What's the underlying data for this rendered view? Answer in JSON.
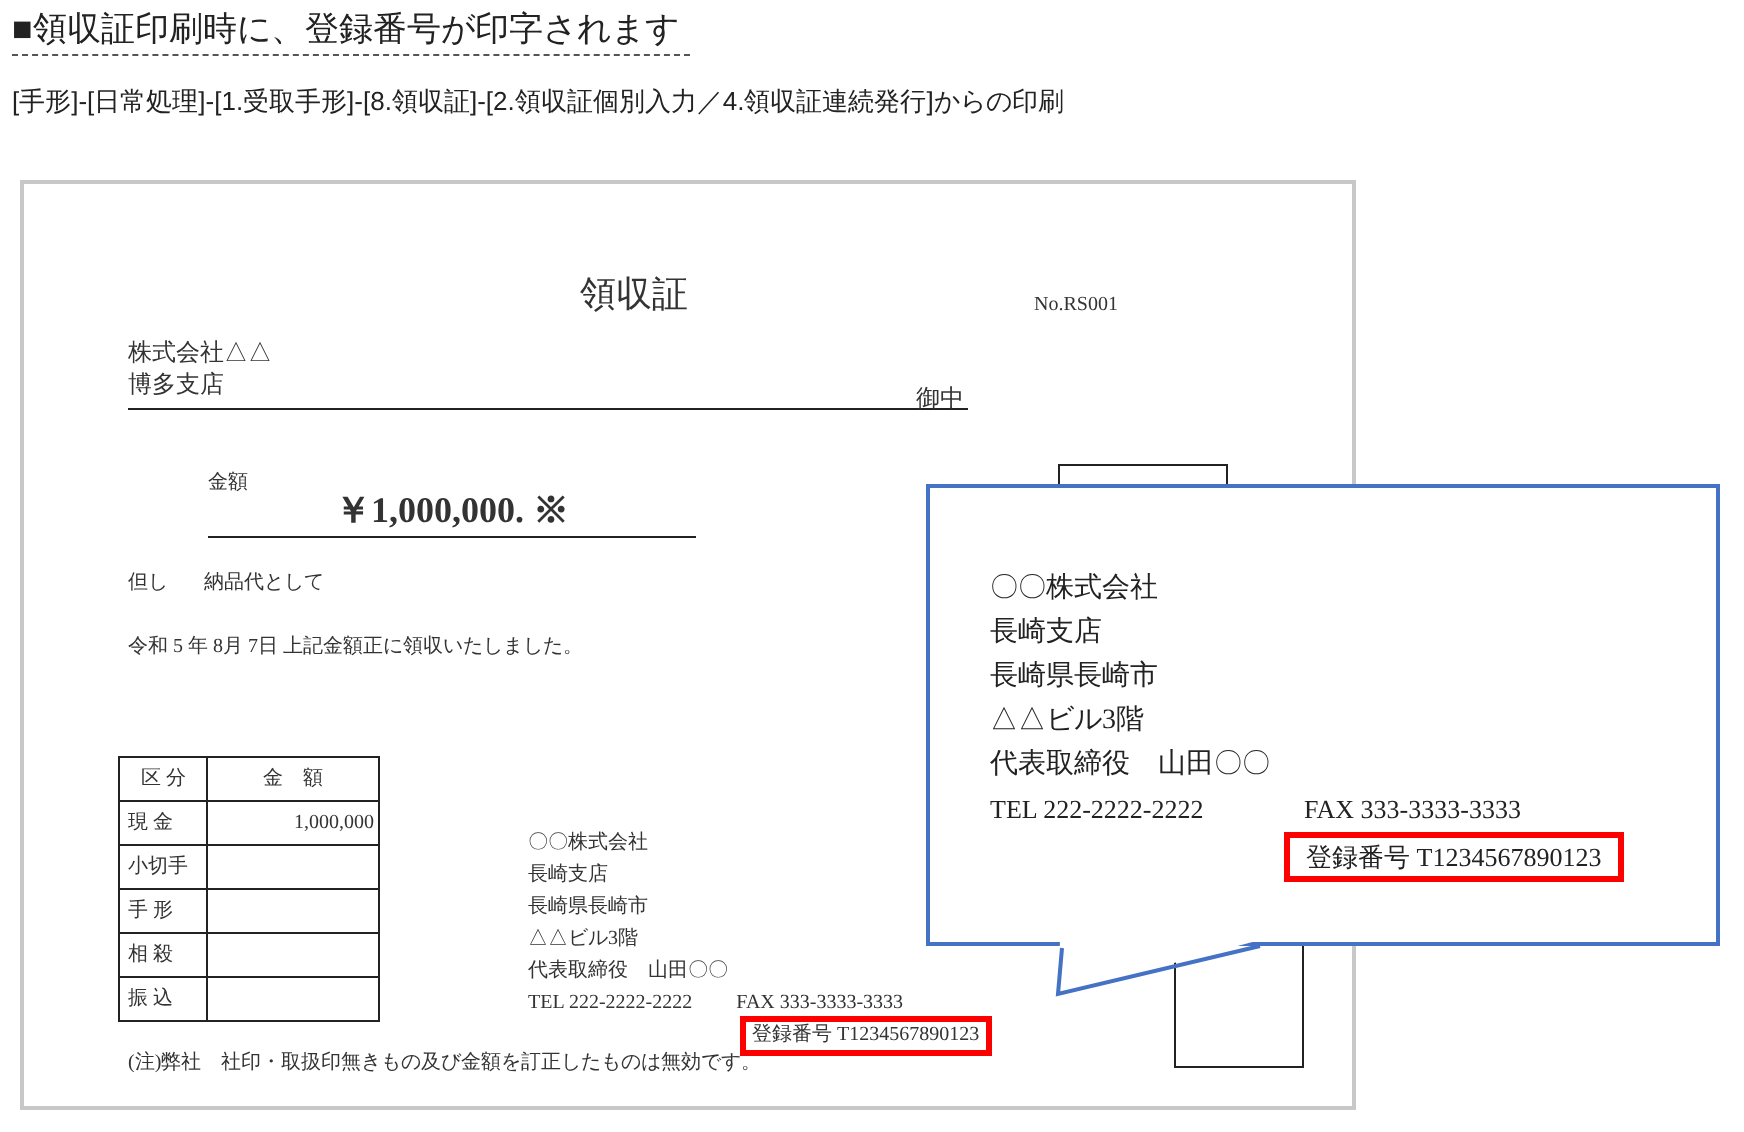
{
  "heading": "■領収証印刷時に、登録番号が印字されます",
  "breadcrumb": "[手形]-[日常処理]-[1.受取手形]-[8.領収証]-[2.領収証個別入力／4.領収証連続発行]からの印刷",
  "receipt": {
    "title": "領収証",
    "number": "No.RS001",
    "addressee_lines": [
      "株式会社△△",
      "博多支店"
    ],
    "honorific": "御中",
    "amount_label": "金額",
    "amount": "￥1,000,000. ※",
    "proviso_label": "但し",
    "proviso": "納品代として",
    "date_line": "令和 5 年 8月 7日 上記金額正に領収いたしました。",
    "table": {
      "columns": [
        "区 分",
        "金　額"
      ],
      "rows": [
        {
          "label": "現 金",
          "amount": "1,000,000"
        },
        {
          "label": "小切手"
        },
        {
          "label": "手 形"
        },
        {
          "label": "相 殺"
        },
        {
          "label": "振 込"
        }
      ]
    },
    "issuer": {
      "lines": [
        "〇〇株式会社",
        "長崎支店",
        "長崎県長崎市",
        "△△ビル3階",
        "代表取締役　山田〇〇"
      ],
      "tel": "TEL 222-2222-2222",
      "fax": "FAX 333-3333-3333",
      "registration": "登録番号 T1234567890123"
    },
    "note": "(注)弊社　社印・取扱印無きもの及び金額を訂正したものは無効です。"
  },
  "callout": {
    "lines": [
      "〇〇株式会社",
      "長崎支店",
      "長崎県長崎市",
      "△△ビル3階",
      "代表取締役　山田〇〇"
    ],
    "tel": "TEL 222-2222-2222",
    "fax": "FAX 333-3333-3333",
    "registration": "登録番号 T1234567890123"
  }
}
